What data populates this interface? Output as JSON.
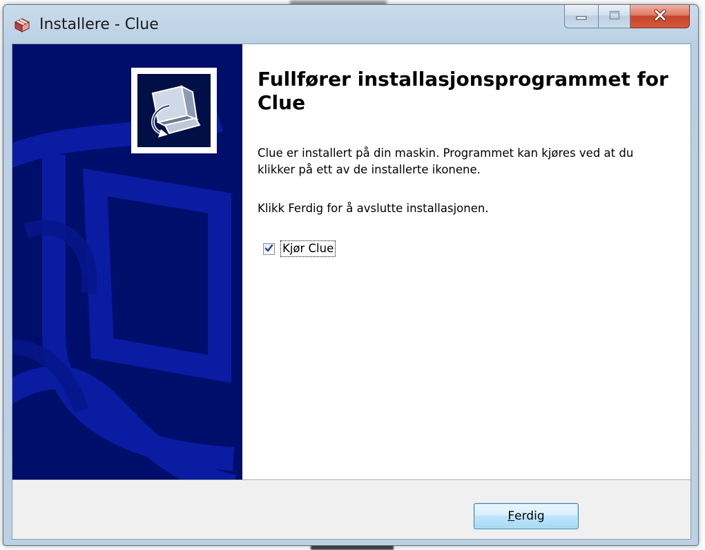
{
  "window": {
    "title": "Installere - Clue",
    "icon": "installer-box-icon",
    "caption_buttons": [
      "minimize-icon",
      "maximize-icon",
      "close-icon"
    ]
  },
  "wizard": {
    "banner_icon": "computer-install-icon",
    "heading": "Fullfører installasjonsprogrammet for Clue",
    "paragraph1": "Clue er installert på din maskin. Programmet kan kjøres ved at du klikker på ett av de installerte ikonene.",
    "paragraph2": "Klikk Ferdig for å avslutte installasjonen.",
    "run_checkbox": {
      "label": "Kjør Clue",
      "checked": true
    }
  },
  "buttons": {
    "finish_access_key": "F",
    "finish_rest": "erdig"
  },
  "colors": {
    "banner": "#000e6b",
    "banner_accent": "#0a1ea8",
    "client_bg": "#f0f0f0",
    "close_button": "#c7452a",
    "button_border": "#3c7fb1"
  }
}
